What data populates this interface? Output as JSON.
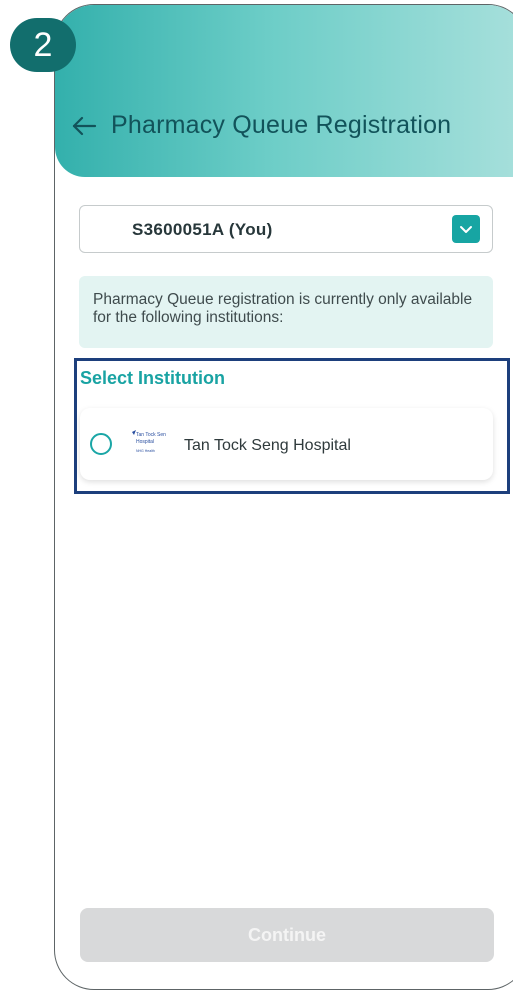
{
  "step": {
    "number": "2"
  },
  "header": {
    "title": "Pharmacy Queue Registration",
    "back_icon": "arrow-left-icon"
  },
  "patient_select": {
    "selected": "S3600051A (You)",
    "toggle_icon": "chevron-down-icon"
  },
  "info": {
    "message": "Pharmacy Queue registration is currently only available for the following institutions:"
  },
  "institutions": {
    "label": "Select Institution",
    "items": [
      {
        "name": "Tan Tock Seng Hospital",
        "selected": false,
        "logo_text": "Tan Tock Seng Hospital",
        "logo_subtext": "NHG Health"
      }
    ]
  },
  "actions": {
    "continue_label": "Continue"
  },
  "colors": {
    "brand_teal": "#17a5a3",
    "badge": "#126e6d",
    "highlight_border": "#1d3f7c",
    "disabled_button": "#d8d9da"
  }
}
